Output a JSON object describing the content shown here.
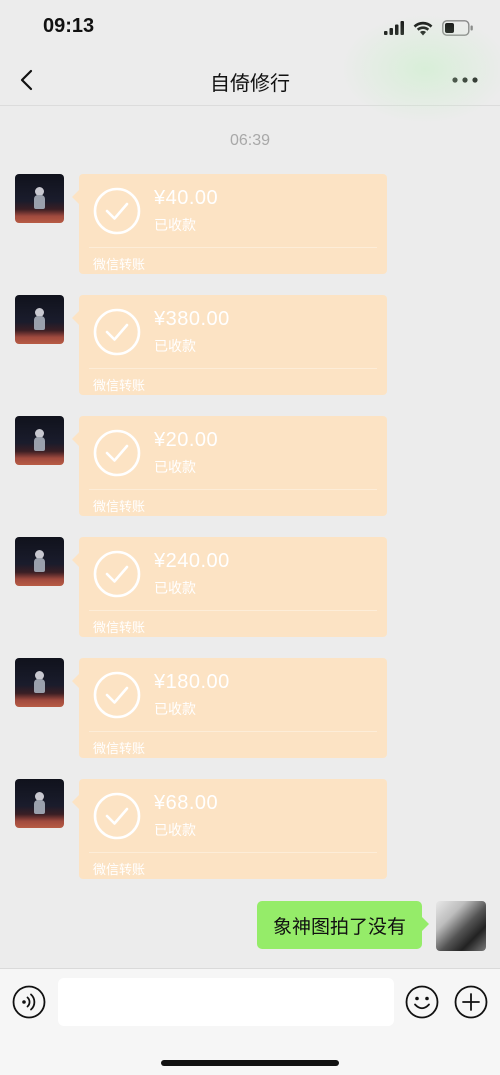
{
  "status_bar": {
    "time": "09:13",
    "icons": [
      "signal-icon",
      "wifi-icon",
      "battery-icon"
    ]
  },
  "header": {
    "title": "自倚修行",
    "back_icon": "chevron-left-icon",
    "more_icon": "more-dots-icon"
  },
  "chat": {
    "timestamp": "06:39",
    "transfers": [
      {
        "amount": "¥40.00",
        "status": "已收款",
        "footer": "微信转账"
      },
      {
        "amount": "¥380.00",
        "status": "已收款",
        "footer": "微信转账"
      },
      {
        "amount": "¥20.00",
        "status": "已收款",
        "footer": "微信转账"
      },
      {
        "amount": "¥240.00",
        "status": "已收款",
        "footer": "微信转账"
      },
      {
        "amount": "¥180.00",
        "status": "已收款",
        "footer": "微信转账"
      },
      {
        "amount": "¥68.00",
        "status": "已收款",
        "footer": "微信转账"
      }
    ],
    "outgoing_message": "象神图拍了没有"
  },
  "input_bar": {
    "value": "",
    "icons": [
      "voice-icon",
      "emoji-icon",
      "plus-icon"
    ]
  },
  "colors": {
    "background": "#ececec",
    "transfer_card": "#fce3c4",
    "outgoing_bubble": "#95ec69"
  }
}
